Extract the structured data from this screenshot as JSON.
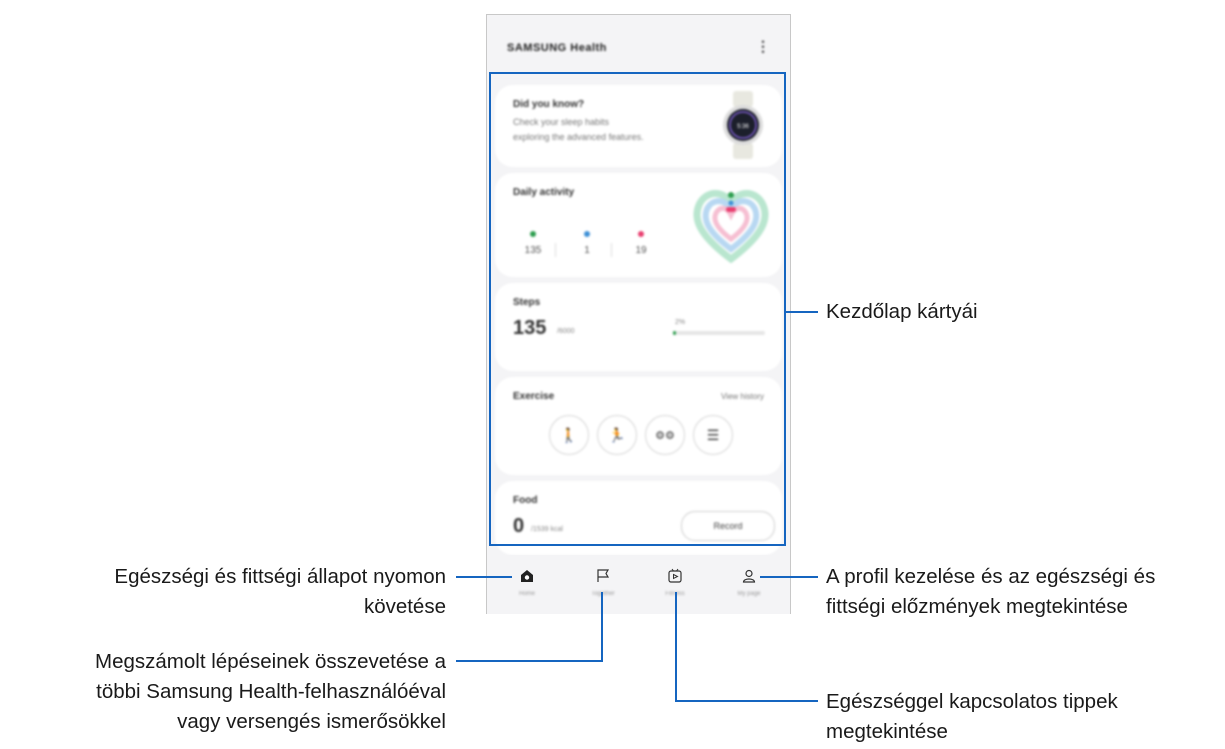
{
  "app": {
    "title": "SAMSUNG Health",
    "more_icon": "more-vertical-icon"
  },
  "cards": {
    "tip": {
      "title": "Did you know?",
      "line1": "Check your sleep habits",
      "line2": "exploring the advanced features.",
      "watch_time": "5:36"
    },
    "daily": {
      "title": "Daily activity",
      "stats": [
        "135",
        "1",
        "19"
      ]
    },
    "steps": {
      "title": "Steps",
      "value": "135",
      "unit": "/6000",
      "bar_label": "2%",
      "progress": 0.02
    },
    "exercise": {
      "title": "Exercise",
      "link": "View history",
      "buttons": [
        "walking-icon",
        "running-icon",
        "cycling-icon",
        "list-icon"
      ]
    },
    "food": {
      "title": "Food",
      "value": "0",
      "unit": "/1539 kcal",
      "button": "Record"
    }
  },
  "nav": [
    {
      "label": "Home",
      "icon": "home-icon"
    },
    {
      "label": "Together",
      "icon": "flag-icon"
    },
    {
      "label": "Fitness",
      "icon": "play-icon"
    },
    {
      "label": "My page",
      "icon": "person-icon"
    }
  ],
  "annotations": {
    "cards": "Kezdőlap kártyái",
    "home_line1": "Egészségi és fittségi állapot nyomon",
    "home_line2": "követése",
    "together_line1": "Megszámolt lépéseinek összevetése a",
    "together_line2": "többi Samsung Health-felhasználóéval",
    "together_line3": "vagy versengés ismerősökkel",
    "mypage_line1": "A profil kezelése és az egészségi és",
    "mypage_line2": "fittségi előzmények megtekintése",
    "fitness_line1": "Egészséggel kapcsolatos tippek",
    "fitness_line2": "megtekintése"
  },
  "colors": {
    "callout": "#1565c0",
    "steps_green": "#2e9e4f",
    "active_blue": "#3d8fd6",
    "calorie_pink": "#e83e6f"
  }
}
